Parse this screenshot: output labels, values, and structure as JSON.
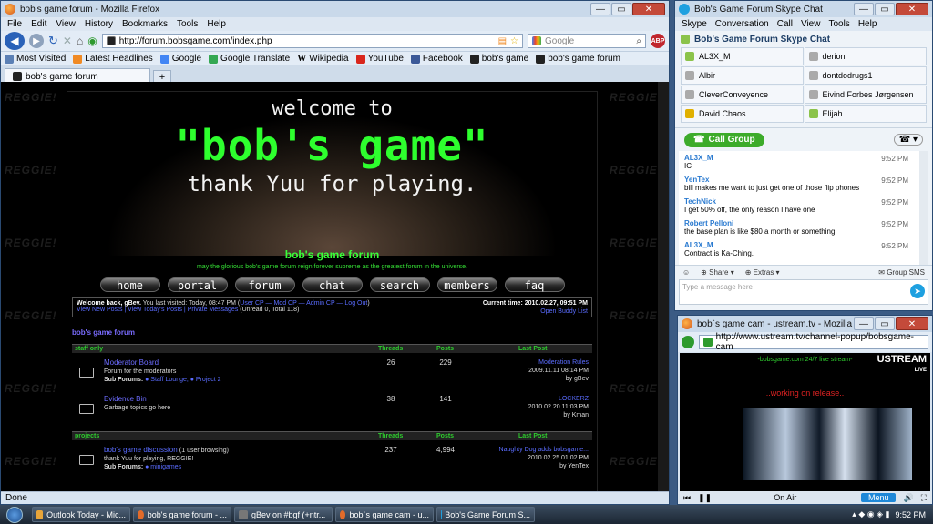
{
  "firefox": {
    "title": "bob's game forum - Mozilla Firefox",
    "menu": [
      "File",
      "Edit",
      "View",
      "History",
      "Bookmarks",
      "Tools",
      "Help"
    ],
    "url": "http://forum.bobsgame.com/index.php",
    "search_placeholder": "Google",
    "bookmarks": [
      "Most Visited",
      "Latest Headlines",
      "Google",
      "Google Translate",
      "Wikipedia",
      "YouTube",
      "Facebook",
      "bob's game",
      "bob's game forum"
    ],
    "tab": "bob's game forum",
    "status": "Done"
  },
  "forum": {
    "watermark": "REGGIE!",
    "banner_line1": "welcome to",
    "banner_line2": "\"bob's game\"",
    "banner_line3": "thank Yuu for playing.",
    "title": "bob's game forum",
    "tagline": "may the glorious bob's game forum reign forever supreme as the greatest forum in the universe.",
    "nav": [
      "home",
      "portal",
      "forum",
      "chat",
      "search",
      "members",
      "faq"
    ],
    "welcome_bold": "Welcome back, gBev.",
    "welcome_rest": "You last visited: Today, 08:47 PM (",
    "welcome_links": "User CP — Mod CP — Admin CP — Log Out",
    "welcome_close": ")",
    "welcome_line2_links": "View New Posts | View Today's Posts | Private Messages",
    "welcome_line2_rest": "(Unread 0, Total 118)",
    "current_time": "Current time: 2010.02.27, 09:51 PM",
    "buddy": "Open Buddy List",
    "section": "bob's game forum",
    "cats": [
      {
        "name": "staff only",
        "threads": "Threads",
        "posts": "Posts",
        "last": "Last Post",
        "rows": [
          {
            "name": "Moderator Board",
            "desc": "Forum for the moderators",
            "sub_label": "Sub Forums:",
            "sub": "● Staff Lounge,   ● Project 2",
            "threads": "26",
            "posts": "229",
            "last_title": "Moderation Rules",
            "last_date": "2009.11.11 08:14 PM",
            "last_by": "by gBev"
          },
          {
            "name": "Evidence Bin",
            "desc": "Garbage topics go here",
            "sub_label": "",
            "sub": "",
            "threads": "38",
            "posts": "141",
            "last_title": "LOCKERZ",
            "last_date": "2010.02.20 11:03 PM",
            "last_by": "by Kman"
          }
        ]
      },
      {
        "name": "projects",
        "threads": "Threads",
        "posts": "Posts",
        "last": "Last Post",
        "rows": [
          {
            "name": "bob's game discussion",
            "name_extra": "(1 user browsing)",
            "desc": "thank Yuu for playing, REGGIE!",
            "sub_label": "Sub Forums:",
            "sub": "● minigames",
            "threads": "237",
            "posts": "4,994",
            "last_title": "Naughty Dog adds bobsgame...",
            "last_date": "2010.02.25 01:02 PM",
            "last_by": "by YenTex"
          }
        ]
      }
    ]
  },
  "skype": {
    "title": "Bob's Game Forum Skype Chat",
    "menu": [
      "Skype",
      "Conversation",
      "Call",
      "View",
      "Tools",
      "Help"
    ],
    "chat_title": "Bob's Game Forum Skype Chat",
    "contacts": [
      "AL3X_M",
      "derion",
      "Albir",
      "dontdodrugs1",
      "CleverConveyence",
      "Eivind Forbes Jørgensen",
      "David Chaos",
      "Elijah"
    ],
    "call_group": "Call Group",
    "messages": [
      {
        "name": "AL3X_M",
        "text": "IC",
        "time": "9:52 PM"
      },
      {
        "name": "YenTex",
        "text": "bill makes me want to just get one of those flip phones",
        "time": "9:52 PM"
      },
      {
        "name": "TechNick",
        "text": "I get 50% off, the only reason I have one",
        "time": "9:52 PM"
      },
      {
        "name": "Robert Pelloni",
        "text": "the base plan is like $80 a month or something",
        "time": "9:52 PM"
      },
      {
        "name": "AL3X_M",
        "text": "Contract is Ka-Ching.",
        "time": "9:52 PM"
      }
    ],
    "share": "Share",
    "extras": "Extras",
    "group_sms": "Group SMS",
    "input_placeholder": "Type a message here"
  },
  "cam": {
    "title": "bob`s game cam - ustream.tv - Mozilla Firefox",
    "url": "http://www.ustream.tv/channel-popup/bobsgame-cam",
    "caption": "-bobsgame.com 24/7 live stream-",
    "working": "..working on release..",
    "ustream": "USTREAM",
    "live": "LIVE",
    "on_air": "On Air",
    "menu": "Menu"
  },
  "taskbar": {
    "tasks": [
      "Outlook Today - Mic...",
      "bob's game forum - ...",
      "gBev on #bgf (+ntr...",
      "bob`s game cam - u...",
      "Bob's Game Forum S..."
    ],
    "clock": "9:52 PM"
  },
  "colors": {
    "forum_green": "#2eff2e",
    "skype_green": "#4caf2f",
    "firefox_blue": "#2a62b8"
  }
}
